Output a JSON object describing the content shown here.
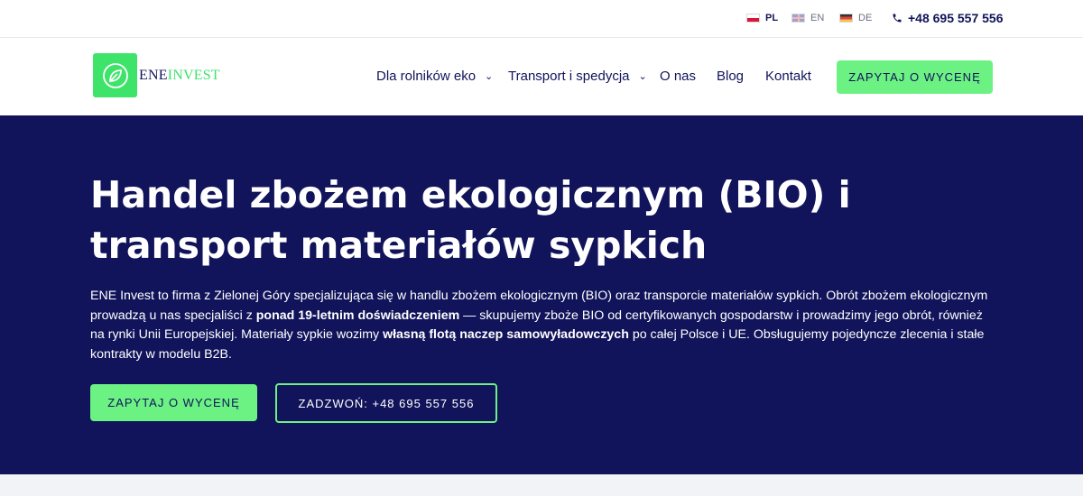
{
  "topbar": {
    "languages": [
      {
        "code": "PL",
        "flag": "pl-flag-icon",
        "active": true
      },
      {
        "code": "EN",
        "flag": "uk-flag-icon",
        "active": false
      },
      {
        "code": "DE",
        "flag": "de-flag-icon",
        "active": false
      }
    ],
    "phone": "+48 695 557 556",
    "phone_icon": "phone-icon"
  },
  "header": {
    "logo": {
      "part1": "ENE",
      "part2": "INVEST",
      "icon": "leaf-icon",
      "color": "#3ee36a"
    },
    "nav": [
      {
        "label": "Dla rolników eko",
        "dropdown": true
      },
      {
        "label": "Transport i spedycja",
        "dropdown": true
      },
      {
        "label": "O nas",
        "dropdown": false
      },
      {
        "label": "Blog",
        "dropdown": false
      },
      {
        "label": "Kontakt",
        "dropdown": false
      }
    ],
    "cta": "ZAPYTAJ O WYCENĘ"
  },
  "hero": {
    "title": "Handel zbożem ekologicznym (BIO) i transport materiałów sypkich",
    "paragraph": {
      "p1": "ENE Invest to firma z Zielonej Góry specjalizująca się w handlu zbożem ekologicznym (BIO) oraz transporcie materiałów sypkich. Obrót zbożem ekologicznym prowadzą u nas specjaliści z ",
      "b1": "ponad 19-letnim doświadczeniem",
      "p2": " — skupujemy zboże BIO od certyfikowanych gospodarstw i prowadzimy jego obrót, również na rynki Unii Europejskiej. Materiały sypkie wozimy ",
      "b2": "własną flotą naczep samowyładowczych",
      "p3": " po całej Polsce i UE. Obsługujemy pojedyncze zlecenia i stałe kontrakty w modelu B2B."
    },
    "btn_primary": "ZAPYTAJ O WYCENĘ",
    "btn_secondary": "ZADZWOŃ: +48 695 557 556"
  },
  "colors": {
    "navy": "#11145a",
    "green": "#6cf283",
    "logo_green": "#3ee36a"
  }
}
